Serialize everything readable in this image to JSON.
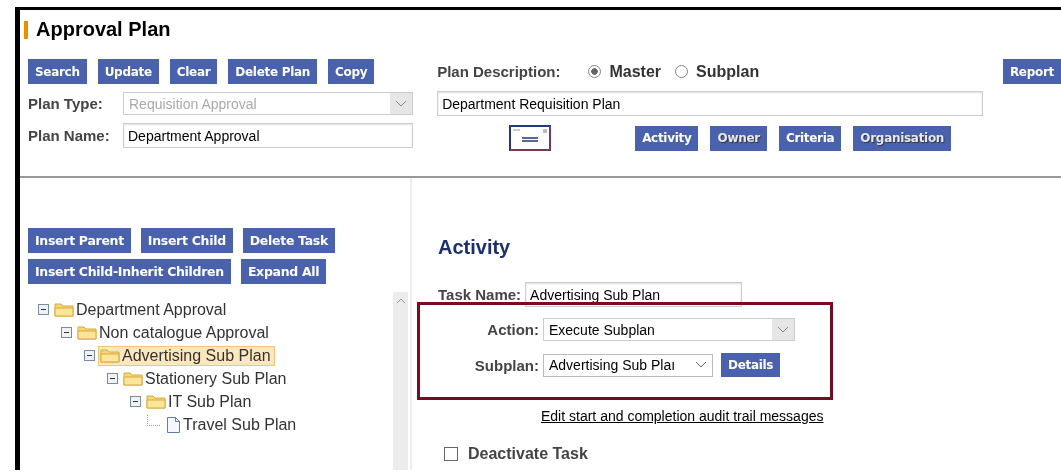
{
  "page": {
    "title": "Approval Plan"
  },
  "toolbar": [
    "Search",
    "Update",
    "Clear",
    "Delete Plan",
    "Copy"
  ],
  "plan_type": {
    "label": "Plan Type:",
    "value": "Requisition Approval",
    "disabled": true
  },
  "plan_name": {
    "label": "Plan Name:",
    "value": "Department Approval"
  },
  "plan_description": {
    "label": "Plan Description:",
    "options": [
      {
        "label": "Master",
        "selected": true
      },
      {
        "label": "Subplan",
        "selected": false
      }
    ],
    "value": "Department Requisition Plan"
  },
  "report_button": "Report",
  "section_buttons": [
    {
      "label": "Activity",
      "disabled": false
    },
    {
      "label": "Owner",
      "disabled": true
    },
    {
      "label": "Criteria",
      "disabled": false
    },
    {
      "label": "Organisation",
      "disabled": true
    }
  ],
  "tree_buttons": [
    [
      "Insert Parent",
      "Insert Child",
      "Delete Task"
    ],
    [
      "Insert Child-Inherit Children",
      "Expand All"
    ]
  ],
  "tree": [
    {
      "label": "Department Approval",
      "kind": "folder",
      "expanded": true,
      "selected": false,
      "children": [
        {
          "label": "Non catalogue Approval",
          "kind": "folder",
          "expanded": true,
          "selected": false,
          "children": [
            {
              "label": "Advertising Sub Plan",
              "kind": "folder",
              "expanded": true,
              "selected": true,
              "children": [
                {
                  "label": "Stationery Sub Plan",
                  "kind": "folder",
                  "expanded": true,
                  "selected": false,
                  "children": [
                    {
                      "label": "IT Sub Plan",
                      "kind": "folder",
                      "expanded": true,
                      "selected": false,
                      "children": [
                        {
                          "label": "Travel Sub Plan",
                          "kind": "file",
                          "selected": false
                        }
                      ]
                    }
                  ]
                }
              ]
            }
          ]
        }
      ]
    }
  ],
  "activity": {
    "heading": "Activity",
    "task_name": {
      "label": "Task Name:",
      "value": "Advertising Sub Plan"
    },
    "action": {
      "label": "Action:",
      "value": "Execute Subplan"
    },
    "subplan": {
      "label": "Subplan:",
      "value": "Advertising Sub Plaı"
    },
    "details_button": "Details",
    "audit_link": "Edit start and completion audit trail messages",
    "deactivate": {
      "label": "Deactivate Task",
      "checked": false
    }
  }
}
